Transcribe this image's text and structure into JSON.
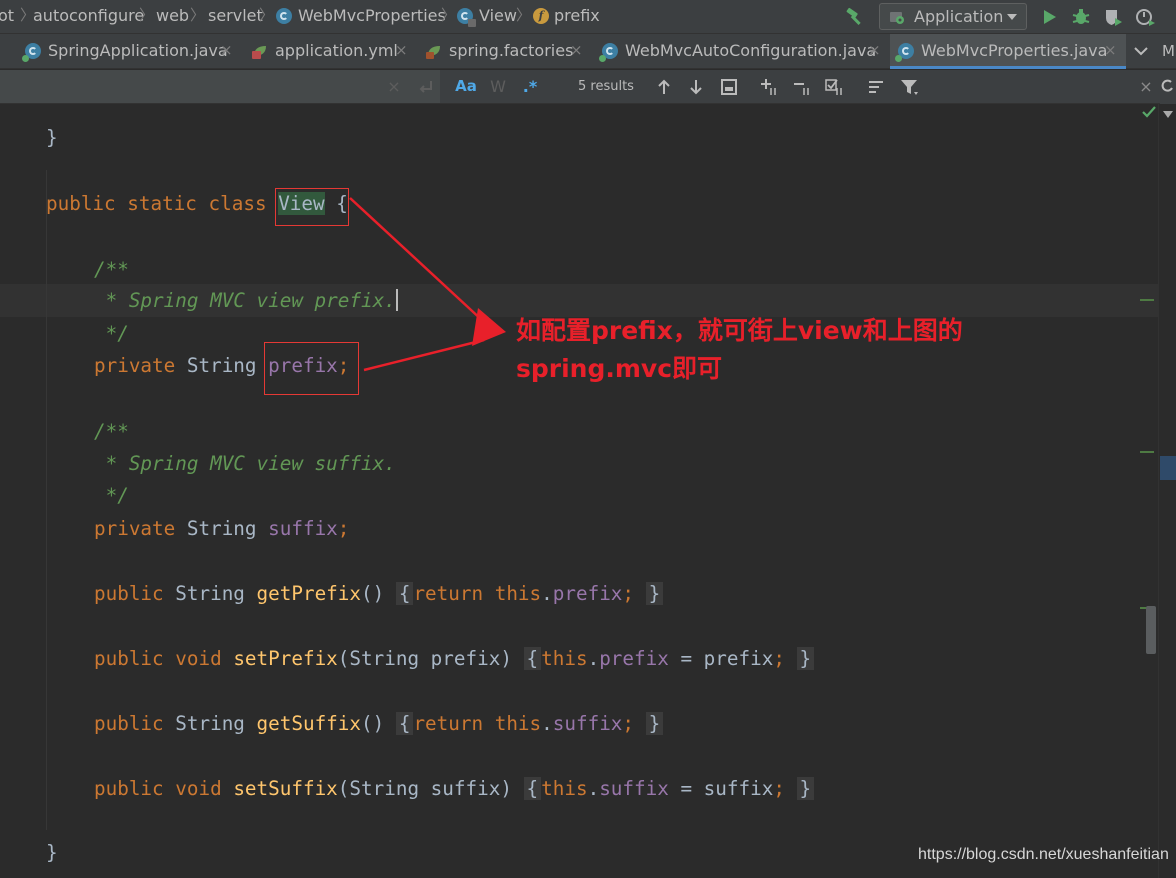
{
  "breadcrumb": {
    "items": [
      {
        "label": "ot",
        "icon": "none"
      },
      {
        "label": "autoconfigure",
        "icon": "none"
      },
      {
        "label": "web",
        "icon": "none"
      },
      {
        "label": "servlet",
        "icon": "none"
      },
      {
        "label": "WebMvcProperties",
        "icon": "class-icon"
      },
      {
        "label": "View",
        "icon": "inner-class-icon"
      },
      {
        "label": "prefix",
        "icon": "field-icon",
        "glyph": "f"
      }
    ]
  },
  "run_config": {
    "label": "Application"
  },
  "tabs": [
    {
      "label": "SpringApplication.java",
      "icon": "class-icon"
    },
    {
      "label": "application.yml",
      "icon": "spring-yml-icon"
    },
    {
      "label": "spring.factories",
      "icon": "spring-factories-icon"
    },
    {
      "label": "WebMvcAutoConfiguration.java",
      "icon": "class-icon"
    },
    {
      "label": "WebMvcProperties.java",
      "icon": "class-icon",
      "active": true
    }
  ],
  "tab_overflow_label": "M",
  "find": {
    "match_case_label": "Aa",
    "whole_words_label": "W",
    "regex_label": ".*",
    "results_text": "5 results",
    "clear_glyph": "×",
    "close_glyph": "×"
  },
  "code": {
    "l1_brace": "}",
    "l2_public": "public",
    "l2_static": "static",
    "l2_class": "class",
    "l2_name": "View",
    "l2_brace": "{",
    "l3": "/**",
    "l4": " * Spring MVC view prefix.",
    "l5": " */",
    "l6_private": "private",
    "l6_type": "String",
    "l6_field": "prefix",
    "l6_semi": ";",
    "l7": "/**",
    "l8": " * Spring MVC view suffix.",
    "l9": " */",
    "l10_private": "private",
    "l10_type": "String",
    "l10_field": "suffix",
    "l10_semi": ";",
    "l11_public": "public",
    "l11_type": "String",
    "l11_method": "getPrefix",
    "l11_parens": "()",
    "l11_open": "{",
    "l11_return": "return",
    "l11_this": "this",
    "l11_dot": ".",
    "l11_field": "prefix",
    "l11_semi": ";",
    "l11_close": "}",
    "l12_public": "public",
    "l12_void": "void",
    "l12_method": "setPrefix",
    "l12_params": "(String prefix)",
    "l12_open": "{",
    "l12_this": "this",
    "l12_dot": ".",
    "l12_field": "prefix",
    "l12_assign": " = prefix",
    "l12_semi": ";",
    "l12_close": "}",
    "l13_public": "public",
    "l13_type": "String",
    "l13_method": "getSuffix",
    "l13_parens": "()",
    "l13_open": "{",
    "l13_return": "return",
    "l13_this": "this",
    "l13_dot": ".",
    "l13_field": "suffix",
    "l13_semi": ";",
    "l13_close": "}",
    "l14_public": "public",
    "l14_void": "void",
    "l14_method": "setSuffix",
    "l14_params": "(String suffix)",
    "l14_open": "{",
    "l14_this": "this",
    "l14_dot": ".",
    "l14_field": "suffix",
    "l14_assign": " = suffix",
    "l14_semi": ";",
    "l14_close": "}",
    "l15_brace": "}"
  },
  "annotation": {
    "line1": "如配置prefix，就可街上view和上图的",
    "line2": "spring.mvc即可"
  },
  "watermark": "https://blog.csdn.net/xueshanfeitian",
  "colors": {
    "keyword": "#cc7832",
    "comment": "#629755",
    "field": "#9876aa",
    "method": "#ffc66d",
    "annotation": "#e8202a",
    "accent": "#4a88c7"
  }
}
